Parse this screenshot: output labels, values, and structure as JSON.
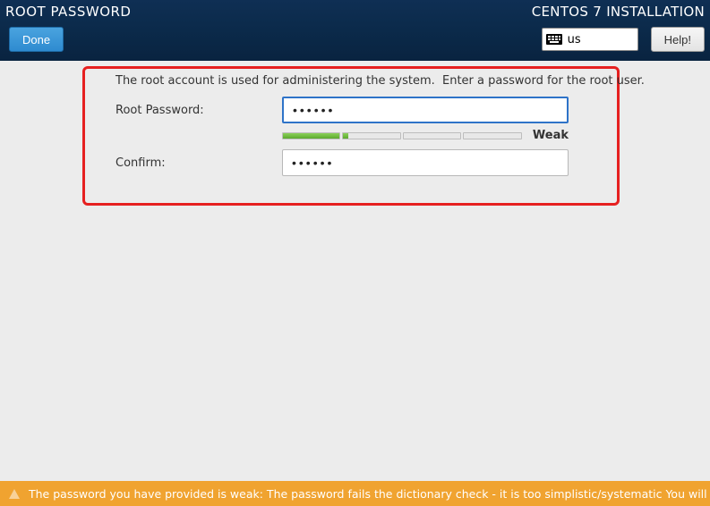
{
  "header": {
    "screen_title": "ROOT PASSWORD",
    "install_title": "CENTOS 7 INSTALLATION",
    "done_label": "Done",
    "help_label": "Help!",
    "keyboard_layout": "us"
  },
  "form": {
    "description": "The root account is used for administering the system.  Enter a password for the root user.",
    "root_password_label": "Root Password:",
    "root_password_value": "••••••",
    "confirm_label": "Confirm:",
    "confirm_value": "••••••",
    "strength_label": "Weak"
  },
  "warning": {
    "text": "The password you have provided is weak: The password fails the dictionary check - it is too simplistic/systematic You will have"
  }
}
